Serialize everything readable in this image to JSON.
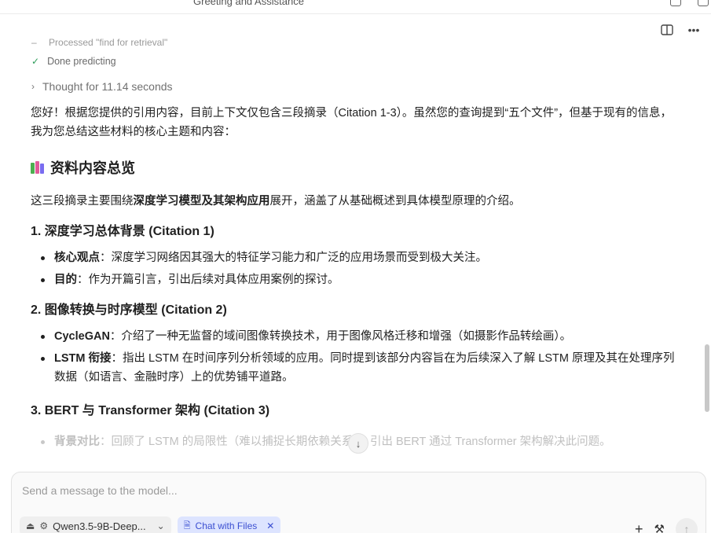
{
  "window": {
    "title": "Greeting and Assistance"
  },
  "toolbar": {
    "panel_icon": "sidebar-panel-icon",
    "more_icon": "more-icon"
  },
  "steps": {
    "faded": "Processed \"find for retrieval\"",
    "done": "Done predicting",
    "thought": "Thought for 11.14 seconds"
  },
  "answer": {
    "intro": "您好！根据您提供的引用内容，目前上下文仅包含三段摘录（Citation 1-3）。虽然您的查询提到“五个文件”，但基于现有的信息，我为您总结这些材料的核心主题和内容：",
    "section_title": "资料内容总览",
    "overview_pre": "这三段摘录主要围绕",
    "overview_bold": "深度学习模型及其架构应用",
    "overview_post": "展开，涵盖了从基础概述到具体模型原理的介绍。",
    "sections": [
      {
        "heading": "1. 深度学习总体背景 (Citation 1)",
        "items": [
          {
            "label": "核心观点",
            "text": "：深度学习网络因其强大的特征学习能力和广泛的应用场景而受到极大关注。"
          },
          {
            "label": "目的",
            "text": "：作为开篇引言，引出后续对具体应用案例的探讨。"
          }
        ]
      },
      {
        "heading": "2. 图像转换与时序模型 (Citation 2)",
        "items": [
          {
            "label": "CycleGAN",
            "text": "：介绍了一种无监督的域间图像转换技术，用于图像风格迁移和增强（如摄影作品转绘画）。"
          },
          {
            "label": "LSTM 衔接",
            "text": "：指出 LSTM 在时间序列分析领域的应用。同时提到该部分内容旨在为后续深入了解 LSTM 原理及其在处理序列数据（如语言、金融时序）上的优势铺平道路。"
          }
        ]
      },
      {
        "heading": "3. BERT 与 Transformer 架构 (Citation 3)",
        "items": [
          {
            "label": "背景对比",
            "text": "：回顾了 LSTM 的局限性（难以捕捉长期依赖关系），引出 BERT 通过 Transformer 架构解决此问题。"
          }
        ]
      }
    ]
  },
  "composer": {
    "placeholder": "Send a message to the model...",
    "model_name": "Qwen3.5-9B-Deep...",
    "files_chip": "Chat with Files"
  },
  "colors": {
    "accent": "#3b4fd1",
    "chip_bg": "#dde4ff",
    "check": "#2e9d5a"
  }
}
